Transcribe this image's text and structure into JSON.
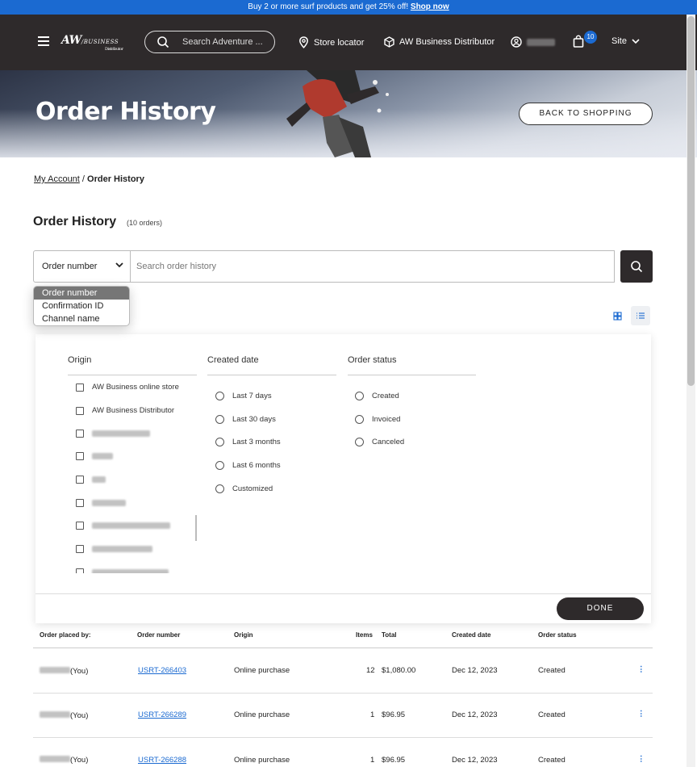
{
  "promo": {
    "text": "Buy 2 or more surf products and get 25% off!",
    "link": "Shop now"
  },
  "header": {
    "logo": "AW",
    "logo_tag": "BUSINESS",
    "logo_sub": "Distributor",
    "search_placeholder": "Search Adventure ...",
    "store_locator": "Store locator",
    "distributor": "AW Business Distributor",
    "cart_count": "10",
    "site": "Site"
  },
  "hero": {
    "title": "Order History",
    "back_button": "BACK TO SHOPPING"
  },
  "breadcrumb": {
    "parent": "My Account",
    "separator": "/",
    "current": "Order History"
  },
  "page": {
    "title": "Order History",
    "count": "(10 orders)"
  },
  "search": {
    "selected": "Order number",
    "placeholder": "Search order history",
    "options": [
      "Order number",
      "Confirmation ID",
      "Channel name"
    ]
  },
  "filters": {
    "origin": {
      "label": "Origin",
      "options": [
        "AW Business online store",
        "AW Business Distributor"
      ]
    },
    "created_date": {
      "label": "Created date",
      "options": [
        "Last 7 days",
        "Last 30 days",
        "Last 3 months",
        "Last 6 months",
        "Customized"
      ]
    },
    "order_status": {
      "label": "Order status",
      "options": [
        "Created",
        "Invoiced",
        "Canceled"
      ]
    },
    "done": "DONE"
  },
  "table": {
    "headers": [
      "Order placed by:",
      "Order number",
      "Origin",
      "Items",
      "Total",
      "Created date",
      "Order status"
    ],
    "rows": [
      {
        "placed_by": "(You)",
        "order_number": "USRT-266403",
        "origin": "Online purchase",
        "items": "12",
        "total": "$1,080.00",
        "date": "Dec 12, 2023",
        "status": "Created"
      },
      {
        "placed_by": "(You)",
        "order_number": "USRT-266289",
        "origin": "Online purchase",
        "items": "1",
        "total": "$96.95",
        "date": "Dec 12, 2023",
        "status": "Created"
      },
      {
        "placed_by": "(You)",
        "order_number": "USRT-266288",
        "origin": "Online purchase",
        "items": "1",
        "total": "$96.95",
        "date": "Dec 12, 2023",
        "status": "Created"
      }
    ]
  },
  "colors": {
    "accent": "#1b6ad1",
    "header_bg": "#2e2a2b"
  }
}
